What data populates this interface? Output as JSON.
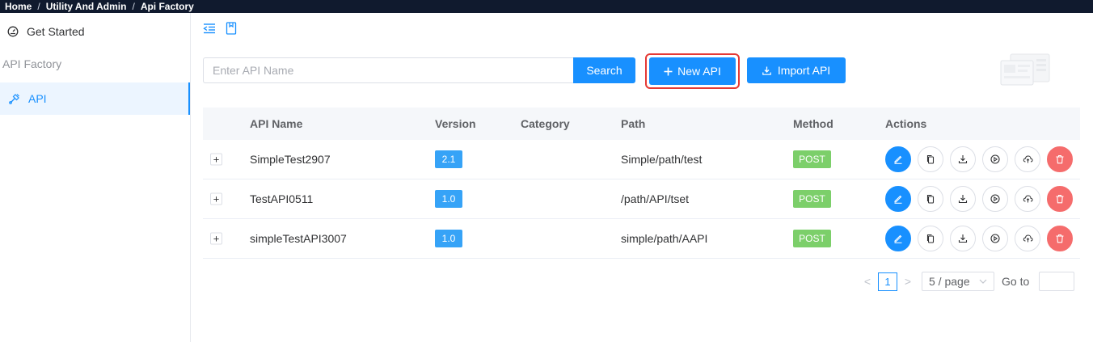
{
  "breadcrumb": [
    "Home",
    "Utility And Admin",
    "Api Factory"
  ],
  "sidebar": {
    "get_started": "Get Started",
    "section": "API Factory",
    "active_item": "API"
  },
  "toolbar": {
    "search_placeholder": "Enter API Name",
    "search_label": "Search",
    "new_api_label": "New API",
    "import_label": "Import API"
  },
  "table": {
    "columns": [
      "API Name",
      "Version",
      "Category",
      "Path",
      "Method",
      "Actions"
    ],
    "rows": [
      {
        "name": "SimpleTest2907",
        "version": "2.1",
        "category": "",
        "path": "Simple/path/test",
        "method": "POST"
      },
      {
        "name": "TestAPI0511",
        "version": "1.0",
        "category": "",
        "path": "/path/API/tset",
        "method": "POST"
      },
      {
        "name": "simpleTestAPI3007",
        "version": "1.0",
        "category": "",
        "path": "simple/path/AAPI",
        "method": "POST"
      }
    ],
    "expand_symbol": "+"
  },
  "pagination": {
    "prev": "<",
    "current": "1",
    "next": ">",
    "page_size": "5 / page",
    "goto_label": "Go to"
  },
  "colors": {
    "primary": "#1890ff",
    "danger": "#f56c6c",
    "success": "#7ccf6a",
    "highlight": "#e53935"
  }
}
